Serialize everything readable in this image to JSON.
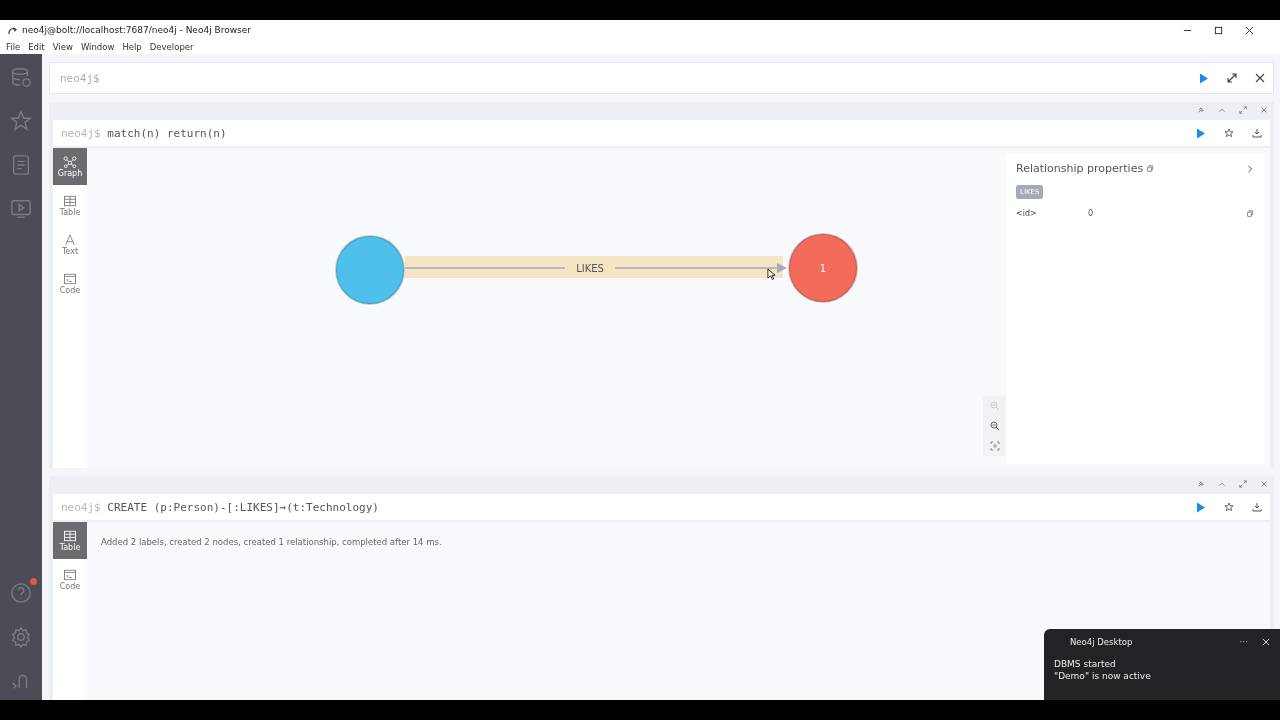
{
  "window": {
    "title": "neo4j@bolt://localhost:7687/neo4j - Neo4j Browser"
  },
  "menu": [
    "File",
    "Edit",
    "View",
    "Window",
    "Help",
    "Developer"
  ],
  "sidebar": {
    "help_notification": true
  },
  "editor": {
    "prompt": "neo4j$"
  },
  "graph_frame": {
    "prompt": "neo4j$",
    "query": "match(n) return(n)",
    "view_tabs": [
      {
        "label": "Graph",
        "kind": "graph",
        "selected": true
      },
      {
        "label": "Table",
        "kind": "table",
        "selected": false
      },
      {
        "label": "Text",
        "kind": "text",
        "selected": false
      },
      {
        "label": "Code",
        "kind": "code",
        "selected": false
      }
    ],
    "nodes": [
      {
        "color": "#4ec0e9"
      },
      {
        "label": "1",
        "color": "#f26b5b"
      }
    ],
    "relationship": {
      "type": "LIKES",
      "selected": true
    },
    "properties": {
      "title": "Relationship properties",
      "badge": "LIKES",
      "rows": [
        {
          "key": "<id>",
          "value": "0"
        }
      ]
    }
  },
  "result_frame": {
    "prompt": "neo4j$",
    "query": "CREATE (p:Person)-[:LIKES]→(t:Technology)",
    "view_tabs": [
      {
        "label": "Table",
        "kind": "table",
        "selected": true
      },
      {
        "label": "Code",
        "kind": "code",
        "selected": false
      }
    ],
    "message": "Added 2 labels, created 2 nodes, created 1 relationship, completed after 14 ms."
  },
  "toast": {
    "app": "Neo4j Desktop",
    "more": "···",
    "title": "DBMS started",
    "message": "\"Demo\" is now active"
  }
}
